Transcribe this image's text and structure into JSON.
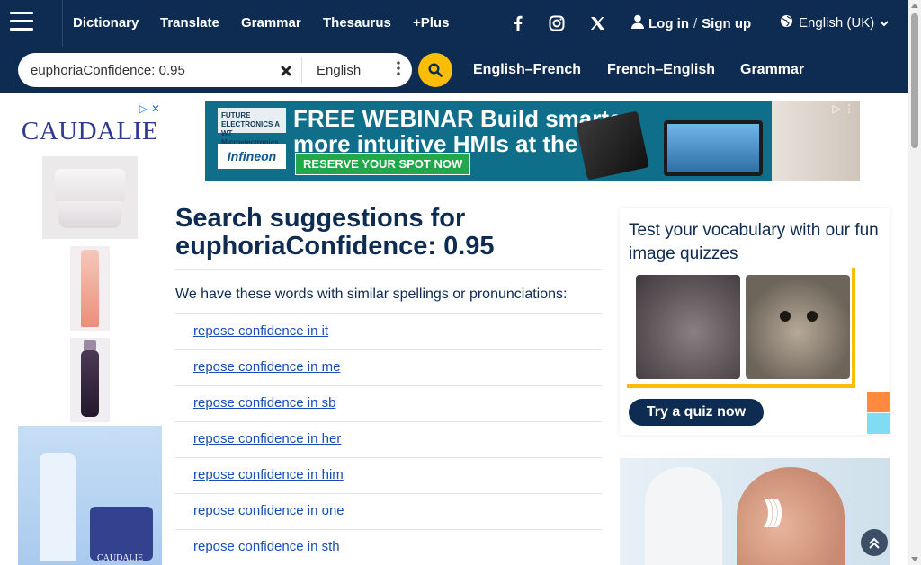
{
  "nav": {
    "links": [
      "Dictionary",
      "Translate",
      "Grammar",
      "Thesaurus",
      "+Plus"
    ],
    "login": "Log in",
    "separator": "/",
    "signup": "Sign up",
    "language": "English (UK)"
  },
  "search": {
    "value": "euphoriaConfidence: 0.95",
    "dictionary": "English",
    "quick_links": [
      "English–French",
      "French–English",
      "Grammar"
    ]
  },
  "left_ad": {
    "brand": "CAUDALIE",
    "small_brand": "CAUDALIE"
  },
  "banner_ad": {
    "brand_top": "FUTURE ELECTRONICS A WT Microelectronics Company",
    "brand_bottom": "Infineon",
    "headline_1": "FREE WEBINAR Build smarter,",
    "headline_2": "more intuitive HMIs at the Edge",
    "cta": "RESERVE YOUR SPOT NOW"
  },
  "main": {
    "title_prefix": "Search suggestions for",
    "query": "euphoriaConfidence: 0.95",
    "intro": "We have these words with similar spellings or pronunciations:",
    "suggestions": [
      "repose confidence in it",
      "repose confidence in me",
      "repose confidence in sb",
      "repose confidence in her",
      "repose confidence in him",
      "repose confidence in one",
      "repose confidence in sth"
    ]
  },
  "quiz": {
    "title": "Test your vocabulary with our fun image quizzes",
    "button": "Try a quiz now"
  },
  "colors": {
    "nav_bg": "#0e2b51",
    "search_button": "#fbbd08",
    "link": "#1a4bb8"
  }
}
